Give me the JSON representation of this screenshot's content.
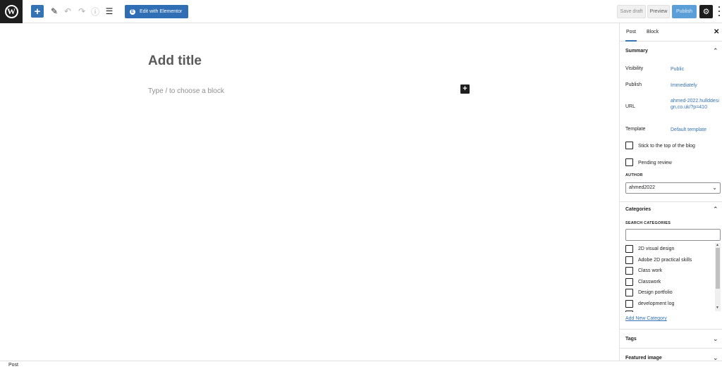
{
  "toolbar": {
    "logo_letter": "W",
    "add_block": "+",
    "edit_elementor": "Edit with Elementor",
    "save_draft": "Save draft",
    "preview": "Preview",
    "publish": "Publish",
    "settings_icon": "⚙"
  },
  "editor": {
    "title_placeholder": "Add title",
    "block_placeholder": "Type / to choose a block",
    "add_block": "+"
  },
  "sidebar": {
    "tabs": [
      "Post",
      "Block"
    ],
    "close": "✕",
    "summary": {
      "heading": "Summary",
      "visibility_label": "Visibility",
      "visibility_value": "Public",
      "publish_label": "Publish",
      "publish_value": "Immediately",
      "url_label": "URL",
      "url_value": "ahmed-2022.hullddesign.co.uk/?p=410",
      "template_label": "Template",
      "template_value": "Default template",
      "stick_label": "Stick to the top of the blog",
      "pending_label": "Pending review",
      "author_heading": "AUTHOR",
      "author_value": "ahmed2022"
    },
    "categories": {
      "heading": "Categories",
      "search_heading": "SEARCH CATEGORIES",
      "items": [
        "2D visual design",
        "Adobe 2D practical skills",
        "Class work",
        "Classwork",
        "Design portfolio",
        "development log"
      ],
      "add_new": "Add New Category"
    },
    "tags_heading": "Tags",
    "featured_heading": "Featured image"
  },
  "footer": {
    "breadcrumb": "Post"
  },
  "colors": {
    "accent": "#3473b4",
    "dark": "#1e1e1e",
    "publish_bg": "#5a9fd8"
  }
}
